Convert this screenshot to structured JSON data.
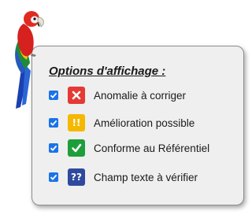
{
  "panel": {
    "title": "Options d'affichage :",
    "options": [
      {
        "label": "Anomalie à corriger",
        "checked": true,
        "icon": "x-icon",
        "color": "#e53935"
      },
      {
        "label": "Amélioration possible",
        "checked": true,
        "icon": "exclamation-icon",
        "glyph": "!!",
        "color": "#f5b800"
      },
      {
        "label": "Conforme au Référentiel",
        "checked": true,
        "icon": "checkmark-icon",
        "color": "#1e9e3a"
      },
      {
        "label": "Champ texte à vérifier",
        "checked": true,
        "icon": "question-icon",
        "glyph": "??",
        "color": "#2e4a9e"
      }
    ]
  }
}
